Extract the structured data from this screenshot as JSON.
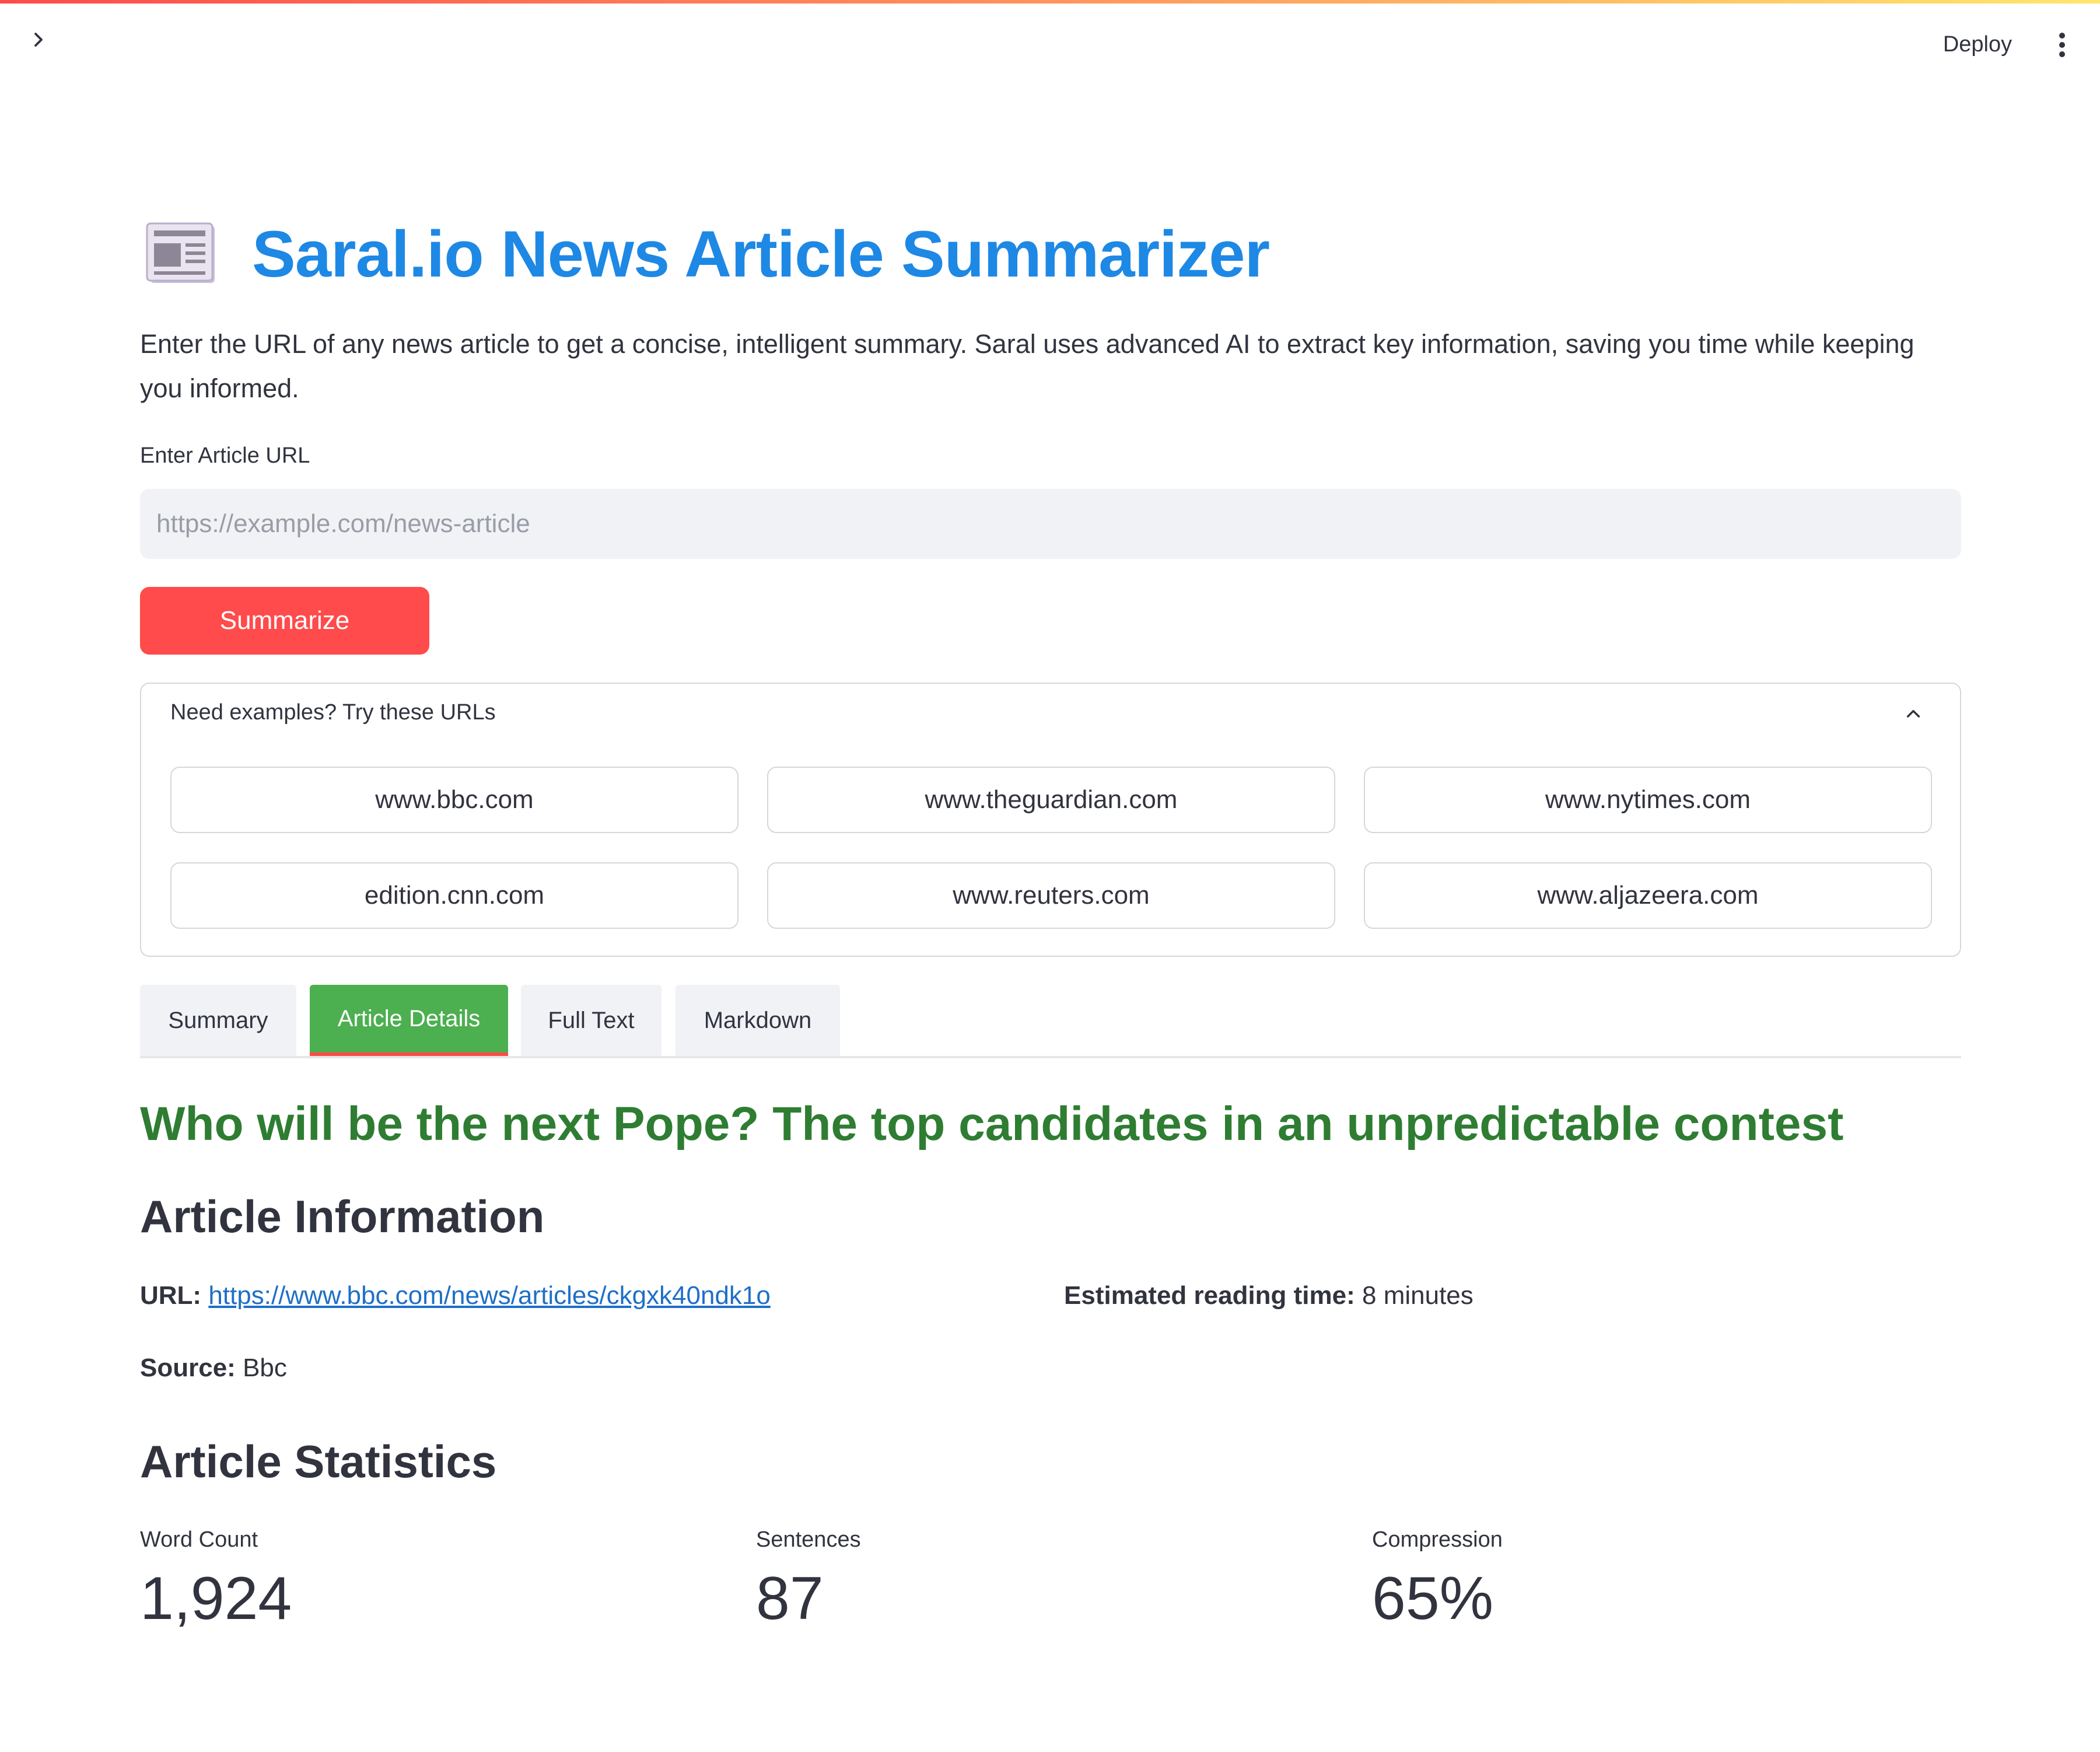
{
  "header": {
    "deploy_label": "Deploy"
  },
  "app": {
    "title": "Saral.io News Article Summarizer",
    "intro": "Enter the URL of any news article to get a concise, intelligent summary. Saral uses advanced AI to extract key information, saving you time while keeping you informed."
  },
  "form": {
    "label": "Enter Article URL",
    "placeholder": "https://example.com/news-article",
    "value": "",
    "submit_label": "Summarize"
  },
  "examples": {
    "title": "Need examples? Try these URLs",
    "expanded": true,
    "urls": [
      "www.bbc.com",
      "www.theguardian.com",
      "www.nytimes.com",
      "edition.cnn.com",
      "www.reuters.com",
      "www.aljazeera.com"
    ]
  },
  "tabs": [
    {
      "label": "Summary",
      "active": false
    },
    {
      "label": "Article Details",
      "active": true
    },
    {
      "label": "Full Text",
      "active": false
    },
    {
      "label": "Markdown",
      "active": false
    }
  ],
  "article": {
    "title": "Who will be the next Pope? The top candidates in an unpredictable contest",
    "info_heading": "Article Information",
    "url_label": "URL:",
    "url": "https://www.bbc.com/news/articles/ckgxk40ndk1o",
    "reading_label": "Estimated reading time:",
    "reading_value": "8 minutes",
    "source_label": "Source:",
    "source_value": "Bbc",
    "stats_heading": "Article Statistics",
    "metrics": [
      {
        "label": "Word Count",
        "value": "1,924"
      },
      {
        "label": "Sentences",
        "value": "87"
      },
      {
        "label": "Compression",
        "value": "65%"
      }
    ]
  },
  "colors": {
    "accent": "#ff4b4b",
    "title_blue": "#1e88e5",
    "article_green": "#2e7d32",
    "active_tab_green": "#4caf50",
    "link_blue": "#1e6fc7"
  },
  "icons": {
    "sidebar_toggle": "chevron-right-icon",
    "main_menu": "kebab-menu-icon",
    "title": "newspaper-icon",
    "expander": "chevron-up-icon"
  }
}
